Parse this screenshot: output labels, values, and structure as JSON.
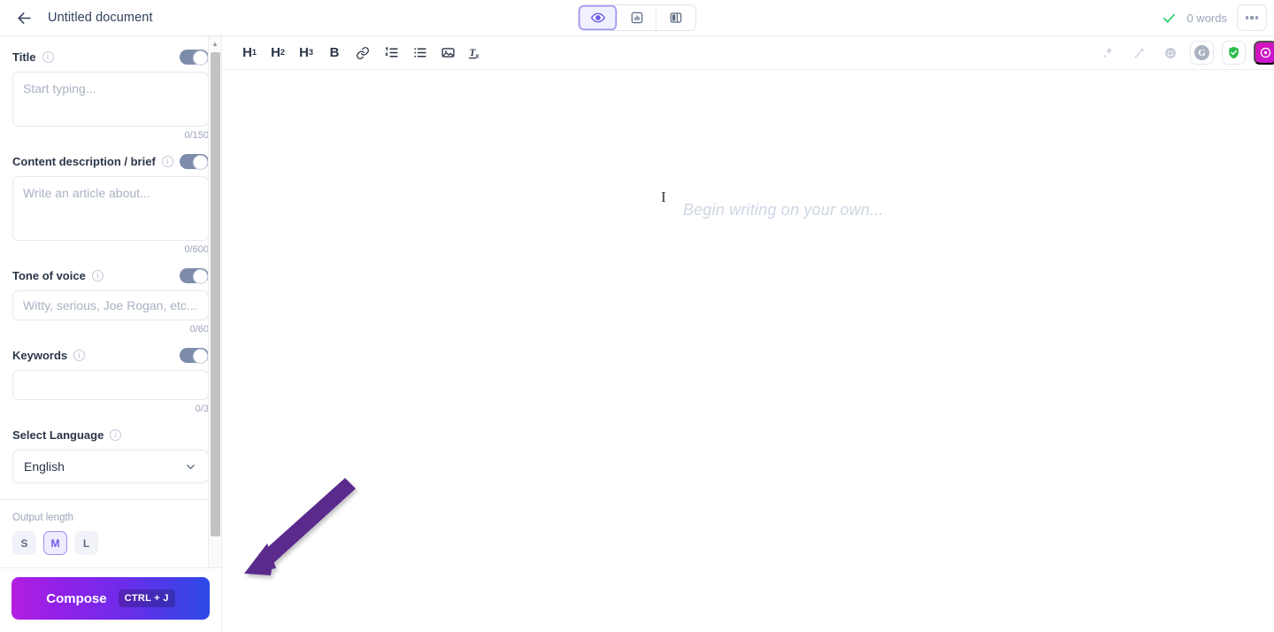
{
  "topbar": {
    "back_icon": "arrow-left-icon",
    "document_title": "Untitled document",
    "view_modes": [
      {
        "name": "preview",
        "icon": "eye-icon",
        "active": true
      },
      {
        "name": "insights",
        "icon": "chart-panel-icon",
        "active": false
      },
      {
        "name": "split-view",
        "icon": "split-panel-icon",
        "active": false
      }
    ],
    "saved_icon": "check-icon",
    "word_count": "0 words",
    "more_label": "more-options"
  },
  "toolbar": {
    "items": [
      {
        "name": "heading-1",
        "label": "H",
        "sub": "1"
      },
      {
        "name": "heading-2",
        "label": "H",
        "sub": "2"
      },
      {
        "name": "heading-3",
        "label": "H",
        "sub": "3"
      },
      {
        "name": "bold",
        "label": "B",
        "sub": ""
      },
      {
        "name": "link",
        "label": "",
        "sub": ""
      },
      {
        "name": "ordered-list",
        "label": "",
        "sub": ""
      },
      {
        "name": "bullet-list",
        "label": "",
        "sub": ""
      },
      {
        "name": "insert-image",
        "label": "",
        "sub": ""
      },
      {
        "name": "clear-formatting",
        "label": "T",
        "sub": "x"
      }
    ],
    "extensions": [
      {
        "name": "sparkle-icon"
      },
      {
        "name": "magic-wand-icon"
      },
      {
        "name": "emoji-icon"
      },
      {
        "name": "grammarly-icon",
        "label": "G"
      },
      {
        "name": "shield-check-icon"
      },
      {
        "name": "ai-assistant-icon"
      }
    ]
  },
  "sidebar": {
    "fields": [
      {
        "name": "title",
        "label": "Title",
        "placeholder": "Start typing...",
        "value": "",
        "counter": "0/150",
        "toggle_on": true
      },
      {
        "name": "content-description",
        "label": "Content description / brief",
        "placeholder": "Write an article about...",
        "value": "",
        "counter": "0/600",
        "toggle_on": true
      },
      {
        "name": "tone-of-voice",
        "label": "Tone of voice",
        "placeholder": "Witty, serious, Joe Rogan, etc...",
        "value": "",
        "counter": "0/60",
        "toggle_on": true
      },
      {
        "name": "keywords",
        "label": "Keywords",
        "placeholder": "",
        "value": "",
        "counter": "0/3",
        "toggle_on": true
      }
    ],
    "language": {
      "label": "Select Language",
      "selected": "English",
      "options": [
        "English"
      ]
    },
    "output_length": {
      "label": "Output length",
      "options": [
        {
          "value": "S",
          "selected": false
        },
        {
          "value": "M",
          "selected": true
        },
        {
          "value": "L",
          "selected": false
        }
      ]
    },
    "compose": {
      "label": "Compose",
      "shortcut": "CTRL + J"
    }
  },
  "editor": {
    "placeholder": "Begin writing on your own...",
    "content": ""
  },
  "annotation": {
    "arrow_color": "#5a2a8c",
    "points_to": "compose-button"
  },
  "colors": {
    "accent_purple": "#6c5ce7",
    "accent_magenta": "#c216cf",
    "saved_green": "#2ecc71",
    "toggle_on": "#7e8cab",
    "arrow": "#5a2a8c"
  }
}
